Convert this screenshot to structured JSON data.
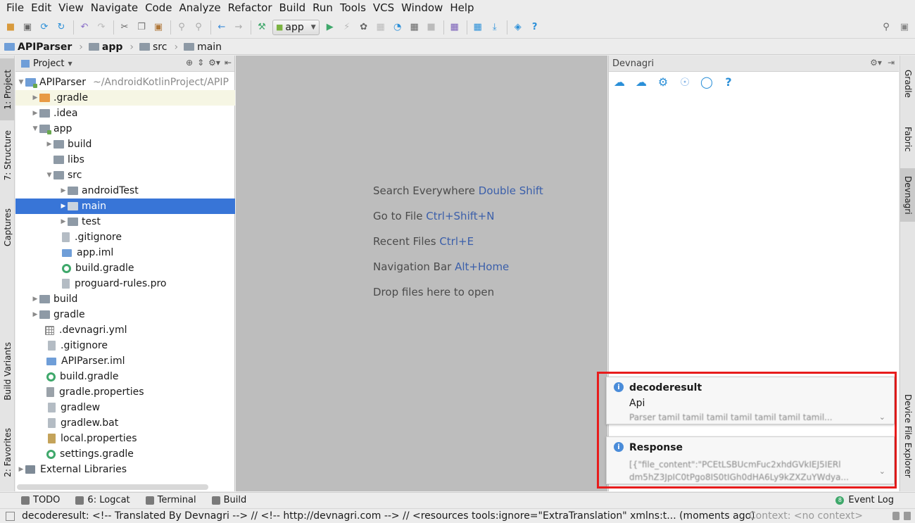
{
  "menu": [
    "File",
    "Edit",
    "View",
    "Navigate",
    "Code",
    "Analyze",
    "Refactor",
    "Build",
    "Run",
    "Tools",
    "VCS",
    "Window",
    "Help"
  ],
  "toolbar": {
    "run_config": "app"
  },
  "breadcrumb": [
    "APIParser",
    "app",
    "src",
    "main"
  ],
  "left_tabs": [
    "1: Project",
    "7: Structure",
    "Captures",
    "Build Variants",
    "2: Favorites"
  ],
  "project_panel": {
    "header": "Project",
    "tree": [
      {
        "label": "APIParser",
        "path": "~/AndroidKotlinProject/APIP"
      },
      {
        "label": ".gradle"
      },
      {
        "label": ".idea"
      },
      {
        "label": "app"
      },
      {
        "label": "build"
      },
      {
        "label": "libs"
      },
      {
        "label": "src"
      },
      {
        "label": "androidTest"
      },
      {
        "label": "main"
      },
      {
        "label": "test"
      },
      {
        "label": ".gitignore"
      },
      {
        "label": "app.iml"
      },
      {
        "label": "build.gradle"
      },
      {
        "label": "proguard-rules.pro"
      },
      {
        "label": "build"
      },
      {
        "label": "gradle"
      },
      {
        "label": ".devnagri.yml"
      },
      {
        "label": ".gitignore"
      },
      {
        "label": "APIParser.iml"
      },
      {
        "label": "build.gradle"
      },
      {
        "label": "gradle.properties"
      },
      {
        "label": "gradlew"
      },
      {
        "label": "gradlew.bat"
      },
      {
        "label": "local.properties"
      },
      {
        "label": "settings.gradle"
      },
      {
        "label": "External Libraries"
      }
    ]
  },
  "editor_hints": [
    {
      "text": "Search Everywhere",
      "key": "Double Shift"
    },
    {
      "text": "Go to File",
      "key": "Ctrl+Shift+N"
    },
    {
      "text": "Recent Files",
      "key": "Ctrl+E"
    },
    {
      "text": "Navigation Bar",
      "key": "Alt+Home"
    },
    {
      "text": "Drop files here to open",
      "key": ""
    }
  ],
  "devnagri": {
    "title": "Devnagri",
    "notifications": [
      {
        "title": "decoderesult",
        "line1": "Api",
        "line2": "Parser tamil tamil tamil tamil tamil tamil tamil..."
      },
      {
        "title": "Response",
        "line1": "[{\"file_content\":\"PCEtLSBUcmFuc2xhdGVkIEJ5IERl",
        "line2": "dm5hZ3JpIC0tPgo8IS0tIGh0dHA6Ly9kZXZuYWdya..."
      }
    ]
  },
  "right_tabs": [
    "Gradle",
    "Fabric",
    "Devnagri",
    "Device File Explorer"
  ],
  "bottom_tabs": [
    "TODO",
    "6: Logcat",
    "Terminal",
    "Build"
  ],
  "event_log": {
    "label": "Event Log",
    "count": "8"
  },
  "status": {
    "message": "decoderesult: <!-- Translated By Devnagri --> // <!-- http://devnagri.com --> // <resources tools:ignore=\"ExtraTranslation\" xmlns:t... (moments ago)",
    "context": "Context: <no context>"
  },
  "colors": {
    "selection": "#3875d7",
    "highlight_border": "#e81c1c",
    "link_key": "#3b5faa"
  }
}
